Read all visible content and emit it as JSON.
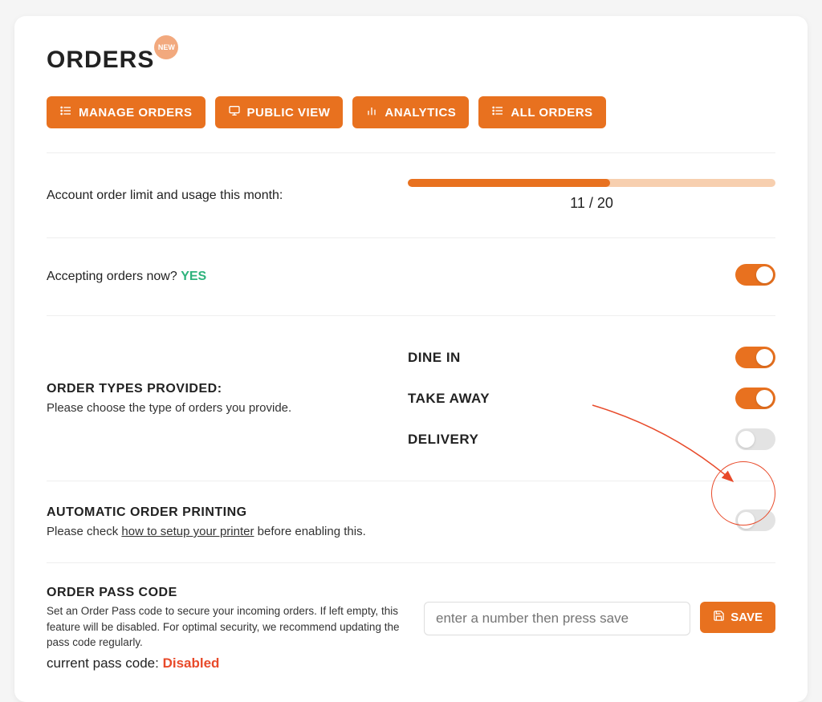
{
  "header": {
    "title": "ORDERS",
    "badge": "NEW"
  },
  "buttons": {
    "manage": "MANAGE ORDERS",
    "public": "PUBLIC VIEW",
    "analytics": "ANALYTICS",
    "all": "ALL ORDERS"
  },
  "usage": {
    "label": "Account order limit and usage this month:",
    "current": 11,
    "limit": 20,
    "display": "11 / 20",
    "percent": 55
  },
  "accepting": {
    "label": "Accepting orders now? ",
    "value": "YES",
    "enabled": true
  },
  "orderTypes": {
    "title": "ORDER TYPES PROVIDED:",
    "subtitle": "Please choose the type of orders you provide.",
    "items": [
      {
        "label": "DINE IN",
        "enabled": true
      },
      {
        "label": "TAKE AWAY",
        "enabled": true
      },
      {
        "label": "DELIVERY",
        "enabled": false
      }
    ]
  },
  "autoPrint": {
    "title": "AUTOMATIC ORDER PRINTING",
    "prefix": "Please check ",
    "link": "how to setup your printer",
    "suffix": " before enabling this.",
    "enabled": false
  },
  "passcode": {
    "title": "ORDER PASS CODE",
    "desc": "Set an Order Pass code to secure your incoming orders. If left empty, this feature will be disabled. For optimal security, we recommend updating the pass code regularly.",
    "currentLabel": "current pass code: ",
    "currentValue": "Disabled",
    "placeholder": "enter a number then press save",
    "saveLabel": "SAVE"
  }
}
